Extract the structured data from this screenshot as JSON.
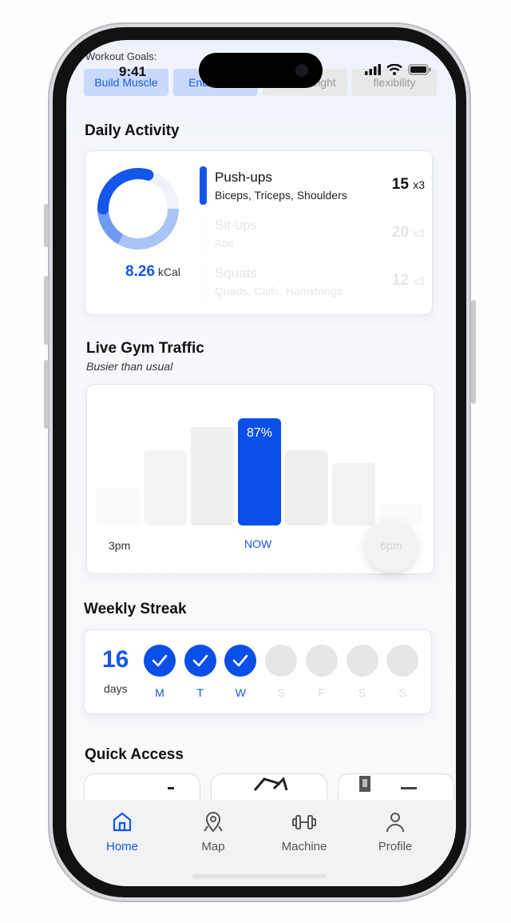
{
  "status_bar": {
    "time": "9:41"
  },
  "workout_goals": {
    "label": "Workout Goals:",
    "chips": [
      {
        "label": "Build Muscle",
        "selected": true
      },
      {
        "label": "Endurance",
        "selected": true
      },
      {
        "label": "Lose Weight",
        "selected": false
      },
      {
        "label": "flexibility",
        "selected": false
      }
    ]
  },
  "daily_activity": {
    "title": "Daily Activity",
    "kcal_value": "8.26",
    "kcal_unit": "kCal",
    "exercises": [
      {
        "name": "Push-ups",
        "muscles": "Biceps, Triceps, Shoulders",
        "reps": "15",
        "sets": "x3",
        "active": true
      },
      {
        "name": "Sit-ups",
        "muscles": "Abs",
        "reps": "20",
        "sets": "x3",
        "active": false
      },
      {
        "name": "Squats",
        "muscles": "Quads, Calfs, Hamstrings",
        "reps": "12",
        "sets": "x3",
        "active": false
      }
    ]
  },
  "gym_traffic": {
    "title": "Live Gym Traffic",
    "subtitle": "Busier than usual",
    "now_value": "87%",
    "labels": {
      "start": "3pm",
      "now": "NOW",
      "end": "6pm"
    }
  },
  "chart_data": {
    "type": "bar",
    "values": [
      35,
      70,
      92,
      100,
      70,
      58,
      20
    ],
    "highlight_index": 3,
    "highlight_label": "87%"
  },
  "weekly_streak": {
    "title": "Weekly Streak",
    "count": "16",
    "unit": "days",
    "days": [
      {
        "label": "M",
        "done": true
      },
      {
        "label": "T",
        "done": true
      },
      {
        "label": "W",
        "done": true
      },
      {
        "label": "S",
        "done": false
      },
      {
        "label": "F",
        "done": false
      },
      {
        "label": "S",
        "done": false
      },
      {
        "label": "S",
        "done": false
      }
    ]
  },
  "quick_access": {
    "title": "Quick Access"
  },
  "tabbar": {
    "items": [
      {
        "label": "Home",
        "icon": "home-icon",
        "active": true
      },
      {
        "label": "Map",
        "icon": "map-pin-icon",
        "active": false
      },
      {
        "label": "Machine",
        "icon": "dumbbell-icon",
        "active": false
      },
      {
        "label": "Profile",
        "icon": "user-icon",
        "active": false
      }
    ]
  },
  "colors": {
    "accent": "#1456ea",
    "chip_bg": "#c9d9fb"
  }
}
